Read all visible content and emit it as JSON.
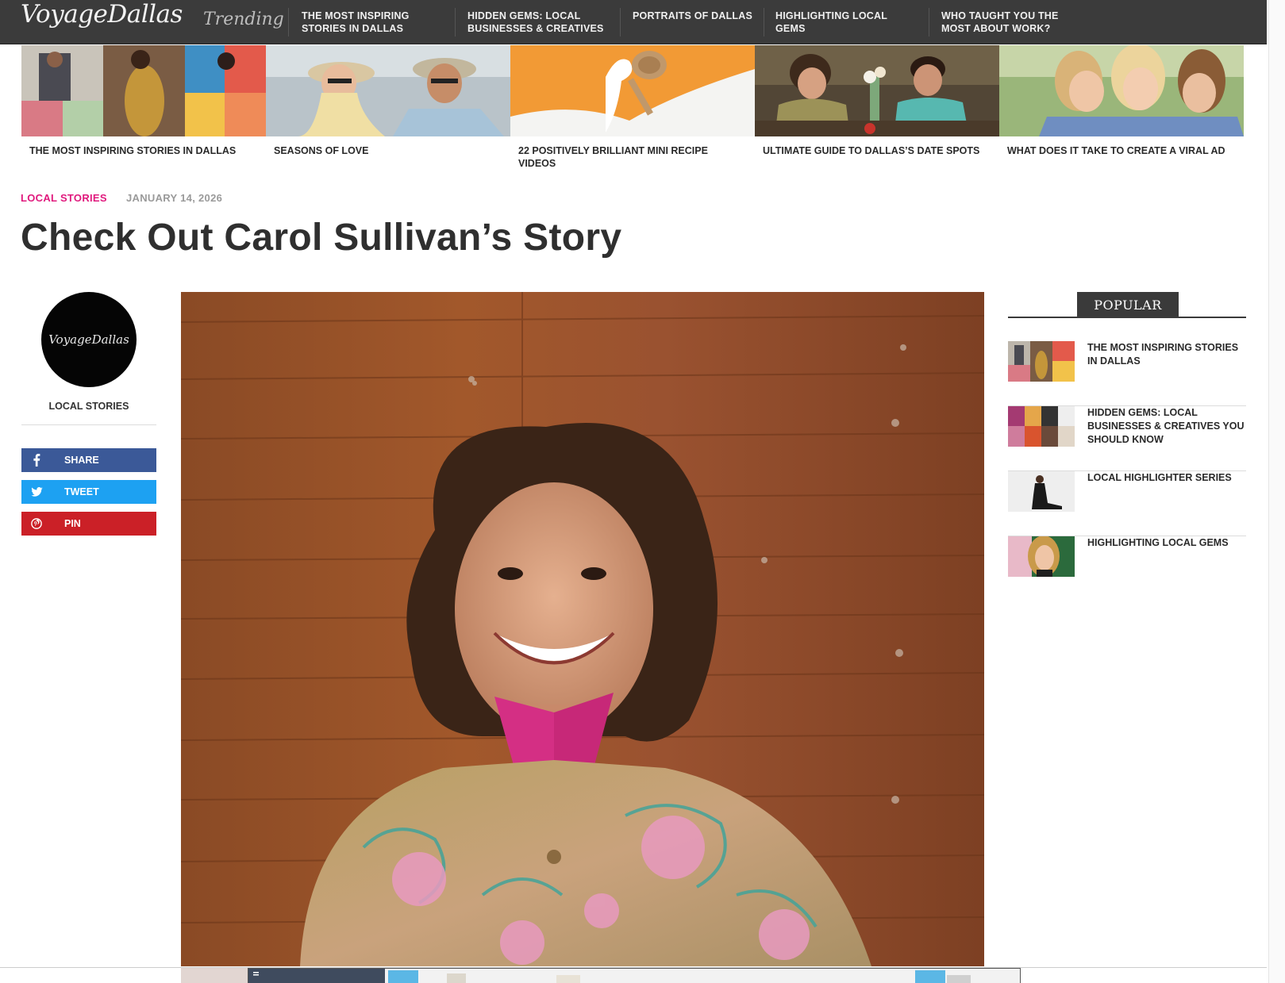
{
  "site": {
    "logo_text": "VoyageDallas",
    "trending_label": "Trending"
  },
  "trending_links": [
    "THE MOST INSPIRING STORIES IN DALLAS",
    "HIDDEN GEMS: LOCAL BUSINESSES & CREATIVES",
    "PORTRAITS OF DALLAS",
    "HIGHLIGHTING LOCAL GEMS",
    "WHO TAUGHT YOU THE MOST ABOUT WORK?"
  ],
  "featured": [
    {
      "caption": "THE MOST INSPIRING STORIES IN DALLAS"
    },
    {
      "caption": "SEASONS OF LOVE"
    },
    {
      "caption": "22 POSITIVELY BRILLIANT MINI RECIPE VIDEOS"
    },
    {
      "caption": "ULTIMATE GUIDE TO DALLAS’S DATE SPOTS"
    },
    {
      "caption": "WHAT DOES IT TAKE TO CREATE A VIRAL AD"
    }
  ],
  "article": {
    "category": "LOCAL STORIES",
    "date": "JANUARY 14, 2026",
    "title": "Check Out Carol Sullivan’s Story"
  },
  "author": {
    "avatar_text": "VoyageDallas",
    "name": "LOCAL STORIES"
  },
  "share": [
    {
      "label": "SHARE",
      "icon": "facebook-icon",
      "color": "#3b5998"
    },
    {
      "label": "TWEET",
      "icon": "twitter-icon",
      "color": "#1da1f2"
    },
    {
      "label": "PIN",
      "icon": "pinterest-icon",
      "color": "#cb2027"
    }
  ],
  "sidebar": {
    "heading": "POPULAR",
    "items": [
      {
        "title": "THE MOST INSPIRING STORIES IN DALLAS"
      },
      {
        "title": "HIDDEN GEMS: LOCAL BUSINESSES & CREATIVES YOU SHOULD KNOW"
      },
      {
        "title": "LOCAL HIGHLIGHTER SERIES"
      },
      {
        "title": "HIGHLIGHTING LOCAL GEMS"
      }
    ]
  },
  "colors": {
    "accent": "#e0197d",
    "topbar": "#3b3b3b"
  }
}
